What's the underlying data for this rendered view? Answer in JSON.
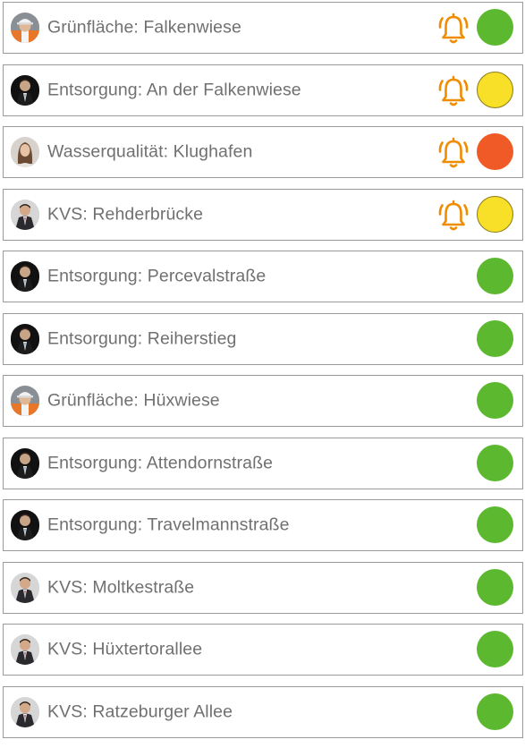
{
  "colors": {
    "green": "#5cb82e",
    "yellow": "#f8e028",
    "red": "#f05a26",
    "bell": "#f08c00",
    "label": "#707070",
    "border": "#9a9a9a"
  },
  "items": [
    {
      "label": "Grünfläche: Falkenwiese",
      "avatar": "worker-avatar",
      "alarm": true,
      "status": "green"
    },
    {
      "label": "Entsorgung: An der Falkenwiese",
      "avatar": "man-dark-avatar",
      "alarm": true,
      "status": "yellow"
    },
    {
      "label": "Wasserqualität: Klughafen",
      "avatar": "woman-avatar",
      "alarm": true,
      "status": "red"
    },
    {
      "label": "KVS: Rehderbrücke",
      "avatar": "man-suit-avatar",
      "alarm": true,
      "status": "yellow"
    },
    {
      "label": "Entsorgung: Percevalstraße",
      "avatar": "man-dark-avatar",
      "alarm": false,
      "status": "green"
    },
    {
      "label": "Entsorgung: Reiherstieg",
      "avatar": "man-dark-avatar",
      "alarm": false,
      "status": "green"
    },
    {
      "label": "Grünfläche: Hüxwiese",
      "avatar": "worker-avatar",
      "alarm": false,
      "status": "green"
    },
    {
      "label": "Entsorgung: Attendornstraße",
      "avatar": "man-dark-avatar",
      "alarm": false,
      "status": "green"
    },
    {
      "label": "Entsorgung: Travelmannstraße",
      "avatar": "man-dark-avatar",
      "alarm": false,
      "status": "green"
    },
    {
      "label": "KVS: Moltkestraße",
      "avatar": "man-suit-avatar",
      "alarm": false,
      "status": "green"
    },
    {
      "label": "KVS: Hüxtertorallee",
      "avatar": "man-suit-avatar",
      "alarm": false,
      "status": "green"
    },
    {
      "label": "KVS: Ratzeburger Allee",
      "avatar": "man-suit-avatar",
      "alarm": false,
      "status": "green"
    }
  ]
}
